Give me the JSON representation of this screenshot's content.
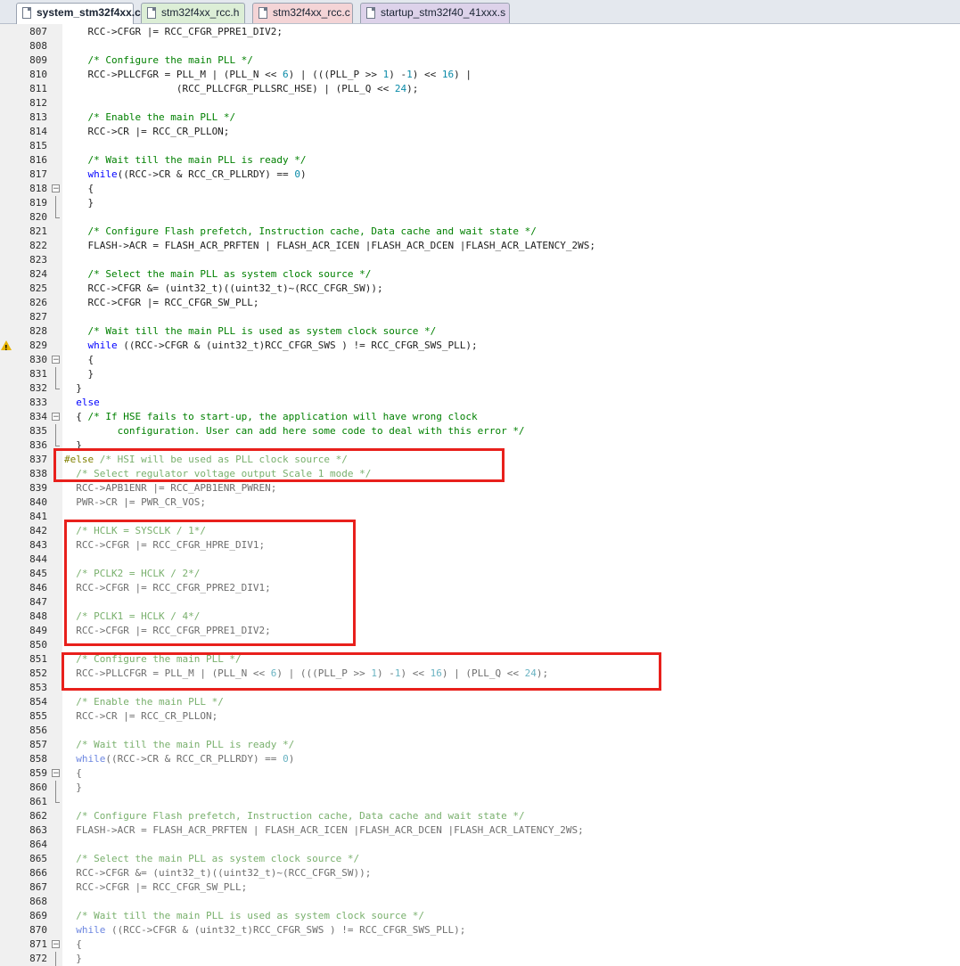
{
  "tabs": [
    {
      "label": "system_stm32f4xx.c",
      "active": true
    },
    {
      "label": "stm32f4xx_rcc.h",
      "active": false
    },
    {
      "label": "stm32f4xx_rcc.c",
      "active": false
    },
    {
      "label": "startup_stm32f40_41xxx.s",
      "active": false
    }
  ],
  "colors": {
    "keyword": "#0000ff",
    "comment": "#008000",
    "number": "#098aa8",
    "preprocessor": "#808000",
    "highlight_box": "#e8201c"
  },
  "code_lines": [
    {
      "n": "807",
      "t": "    RCC->CFGR |= RCC_CFGR_PPRE1_DIV2;"
    },
    {
      "n": "808",
      "t": ""
    },
    {
      "n": "809",
      "t": "    /* Configure the main PLL */"
    },
    {
      "n": "810",
      "t": "    RCC->PLLCFGR = PLL_M | (PLL_N << 6) | (((PLL_P >> 1) -1) << 16) |"
    },
    {
      "n": "811",
      "t": "                   (RCC_PLLCFGR_PLLSRC_HSE) | (PLL_Q << 24);"
    },
    {
      "n": "812",
      "t": ""
    },
    {
      "n": "813",
      "t": "    /* Enable the main PLL */"
    },
    {
      "n": "814",
      "t": "    RCC->CR |= RCC_CR_PLLON;"
    },
    {
      "n": "815",
      "t": ""
    },
    {
      "n": "816",
      "t": "    /* Wait till the main PLL is ready */"
    },
    {
      "n": "817",
      "t": "    while((RCC->CR & RCC_CR_PLLRDY) == 0)"
    },
    {
      "n": "818",
      "t": "    {",
      "fold": "box"
    },
    {
      "n": "819",
      "t": "    }",
      "fold": "mid"
    },
    {
      "n": "820",
      "t": "",
      "fold": "end"
    },
    {
      "n": "821",
      "t": "    /* Configure Flash prefetch, Instruction cache, Data cache and wait state */"
    },
    {
      "n": "822",
      "t": "    FLASH->ACR = FLASH_ACR_PRFTEN | FLASH_ACR_ICEN |FLASH_ACR_DCEN |FLASH_ACR_LATENCY_2WS;"
    },
    {
      "n": "823",
      "t": ""
    },
    {
      "n": "824",
      "t": "    /* Select the main PLL as system clock source */"
    },
    {
      "n": "825",
      "t": "    RCC->CFGR &= (uint32_t)((uint32_t)~(RCC_CFGR_SW));"
    },
    {
      "n": "826",
      "t": "    RCC->CFGR |= RCC_CFGR_SW_PLL;"
    },
    {
      "n": "827",
      "t": ""
    },
    {
      "n": "828",
      "t": "    /* Wait till the main PLL is used as system clock source */"
    },
    {
      "n": "829",
      "t": "    while ((RCC->CFGR & (uint32_t)RCC_CFGR_SWS ) != RCC_CFGR_SWS_PLL);",
      "warn": true
    },
    {
      "n": "830",
      "t": "    {",
      "fold": "box"
    },
    {
      "n": "831",
      "t": "    }",
      "fold": "mid"
    },
    {
      "n": "832",
      "t": "  }",
      "fold": "end"
    },
    {
      "n": "833",
      "t": "  else"
    },
    {
      "n": "834",
      "t": "  { /* If HSE fails to start-up, the application will have wrong clock",
      "fold": "box"
    },
    {
      "n": "835",
      "t": "         configuration. User can add here some code to deal with this error */",
      "fold": "mid"
    },
    {
      "n": "836",
      "t": "  }",
      "fold": "end"
    },
    {
      "n": "837",
      "t": "#else /* HSI will be used as PLL clock source */",
      "inactive": true
    },
    {
      "n": "838",
      "t": "  /* Select regulator voltage output Scale 1 mode */",
      "inactive": true
    },
    {
      "n": "839",
      "t": "  RCC->APB1ENR |= RCC_APB1ENR_PWREN;",
      "inactive": true
    },
    {
      "n": "840",
      "t": "  PWR->CR |= PWR_CR_VOS;",
      "inactive": true
    },
    {
      "n": "841",
      "t": "",
      "inactive": true
    },
    {
      "n": "842",
      "t": "  /* HCLK = SYSCLK / 1*/",
      "inactive": true
    },
    {
      "n": "843",
      "t": "  RCC->CFGR |= RCC_CFGR_HPRE_DIV1;",
      "inactive": true
    },
    {
      "n": "844",
      "t": "",
      "inactive": true
    },
    {
      "n": "845",
      "t": "  /* PCLK2 = HCLK / 2*/",
      "inactive": true
    },
    {
      "n": "846",
      "t": "  RCC->CFGR |= RCC_CFGR_PPRE2_DIV1;",
      "inactive": true
    },
    {
      "n": "847",
      "t": "",
      "inactive": true
    },
    {
      "n": "848",
      "t": "  /* PCLK1 = HCLK / 4*/",
      "inactive": true
    },
    {
      "n": "849",
      "t": "  RCC->CFGR |= RCC_CFGR_PPRE1_DIV2;",
      "inactive": true
    },
    {
      "n": "850",
      "t": "",
      "inactive": true
    },
    {
      "n": "851",
      "t": "  /* Configure the main PLL */",
      "inactive": true
    },
    {
      "n": "852",
      "t": "  RCC->PLLCFGR = PLL_M | (PLL_N << 6) | (((PLL_P >> 1) -1) << 16) | (PLL_Q << 24);",
      "inactive": true
    },
    {
      "n": "853",
      "t": "",
      "inactive": true
    },
    {
      "n": "854",
      "t": "  /* Enable the main PLL */",
      "inactive": true
    },
    {
      "n": "855",
      "t": "  RCC->CR |= RCC_CR_PLLON;",
      "inactive": true
    },
    {
      "n": "856",
      "t": "",
      "inactive": true
    },
    {
      "n": "857",
      "t": "  /* Wait till the main PLL is ready */",
      "inactive": true
    },
    {
      "n": "858",
      "t": "  while((RCC->CR & RCC_CR_PLLRDY) == 0)",
      "inactive": true
    },
    {
      "n": "859",
      "t": "  {",
      "fold": "box",
      "inactive": true
    },
    {
      "n": "860",
      "t": "  }",
      "fold": "mid",
      "inactive": true
    },
    {
      "n": "861",
      "t": "",
      "fold": "end",
      "inactive": true
    },
    {
      "n": "862",
      "t": "  /* Configure Flash prefetch, Instruction cache, Data cache and wait state */",
      "inactive": true
    },
    {
      "n": "863",
      "t": "  FLASH->ACR = FLASH_ACR_PRFTEN | FLASH_ACR_ICEN |FLASH_ACR_DCEN |FLASH_ACR_LATENCY_2WS;",
      "inactive": true
    },
    {
      "n": "864",
      "t": "",
      "inactive": true
    },
    {
      "n": "865",
      "t": "  /* Select the main PLL as system clock source */",
      "inactive": true
    },
    {
      "n": "866",
      "t": "  RCC->CFGR &= (uint32_t)((uint32_t)~(RCC_CFGR_SW));",
      "inactive": true
    },
    {
      "n": "867",
      "t": "  RCC->CFGR |= RCC_CFGR_SW_PLL;",
      "inactive": true
    },
    {
      "n": "868",
      "t": "",
      "inactive": true
    },
    {
      "n": "869",
      "t": "  /* Wait till the main PLL is used as system clock source */",
      "inactive": true
    },
    {
      "n": "870",
      "t": "  while ((RCC->CFGR & (uint32_t)RCC_CFGR_SWS ) != RCC_CFGR_SWS_PLL);",
      "inactive": true
    },
    {
      "n": "871",
      "t": "  {",
      "fold": "box",
      "inactive": true
    },
    {
      "n": "872",
      "t": "  }",
      "fold": "mid",
      "inactive": true
    }
  ]
}
